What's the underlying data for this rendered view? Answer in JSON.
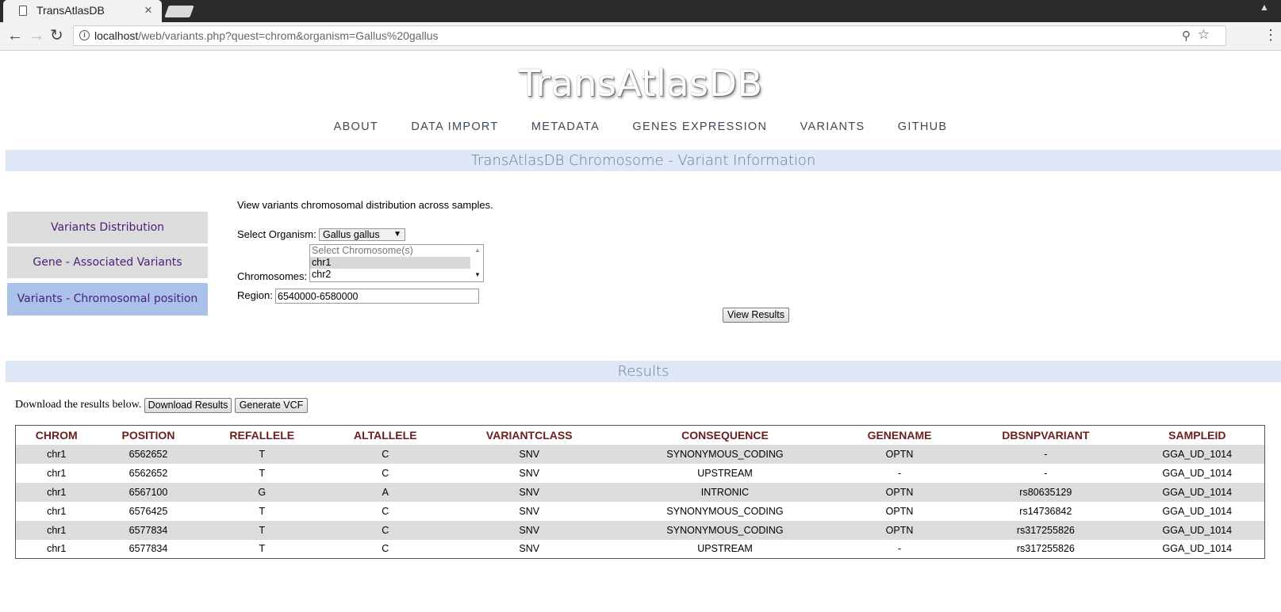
{
  "browser": {
    "tab_title": "TransAtlasDB",
    "tab_close": "×",
    "url_host": "localhost",
    "url_path": "/web/variants.php?quest=chrom&organism=Gallus%20gallus",
    "icons": [
      "page-icon",
      "back-icon",
      "forward-icon",
      "reload-icon",
      "info-icon",
      "zoom-icon",
      "star-icon",
      "menu-icon"
    ]
  },
  "site": {
    "title": "TransAtlasDB",
    "nav": [
      "ABOUT",
      "DATA IMPORT",
      "METADATA",
      "GENES EXPRESSION",
      "VARIANTS",
      "GITHUB"
    ]
  },
  "section_header": "TransAtlasDB Chromosome - Variant Information",
  "sidebar": {
    "items": [
      {
        "label": "Variants Distribution",
        "active": false
      },
      {
        "label": "Gene - Associated Variants",
        "active": false
      },
      {
        "label": "Variants - Chromosomal position",
        "active": true
      }
    ]
  },
  "form": {
    "intro": "View variants chromosomal distribution across samples.",
    "organism_label": "Select Organism:",
    "organism_value": "Gallus gallus",
    "chromosomes_label": "Chromosomes:",
    "chromosome_options": [
      "Select Chromosome(s)",
      "chr1",
      "chr2"
    ],
    "region_label": "Region:",
    "region_value": "6540000-6580000",
    "submit_label": "View Results"
  },
  "results": {
    "header": "Results",
    "download_text": "Download the results below.",
    "download_button": "Download Results",
    "vcf_button": "Generate VCF",
    "columns": [
      "CHROM",
      "POSITION",
      "REFALLELE",
      "ALTALLELE",
      "VARIANTCLASS",
      "CONSEQUENCE",
      "GENENAME",
      "DBSNPVARIANT",
      "SAMPLEID"
    ],
    "rows": [
      [
        "chr1",
        "6562652",
        "T",
        "C",
        "SNV",
        "SYNONYMOUS_CODING",
        "OPTN",
        "-",
        "GGA_UD_1014"
      ],
      [
        "chr1",
        "6562652",
        "T",
        "C",
        "SNV",
        "UPSTREAM",
        "-",
        "-",
        "GGA_UD_1014"
      ],
      [
        "chr1",
        "6567100",
        "G",
        "A",
        "SNV",
        "INTRONIC",
        "OPTN",
        "rs80635129",
        "GGA_UD_1014"
      ],
      [
        "chr1",
        "6576425",
        "T",
        "C",
        "SNV",
        "SYNONYMOUS_CODING",
        "OPTN",
        "rs14736842",
        "GGA_UD_1014"
      ],
      [
        "chr1",
        "6577834",
        "T",
        "C",
        "SNV",
        "SYNONYMOUS_CODING",
        "OPTN",
        "rs317255826",
        "GGA_UD_1014"
      ],
      [
        "chr1",
        "6577834",
        "T",
        "C",
        "SNV",
        "UPSTREAM",
        "-",
        "rs317255826",
        "GGA_UD_1014"
      ]
    ]
  },
  "colors": {
    "band": "#dde7f5",
    "sidebar_active": "#aac1ea",
    "sidebar_inactive": "#dcdcdc",
    "table_header_text": "#6b2020",
    "link_purple": "#4a1f7a"
  }
}
